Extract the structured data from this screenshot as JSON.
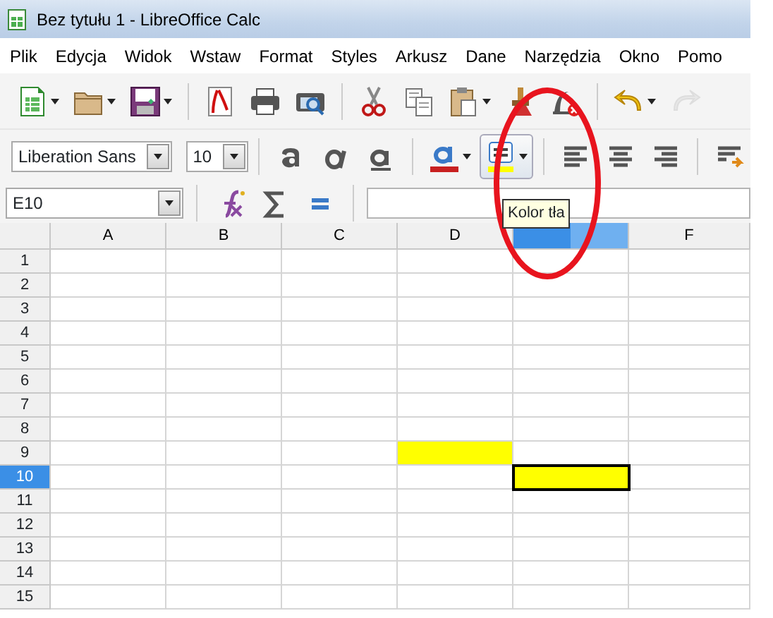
{
  "window": {
    "title": "Bez tytułu 1 - LibreOffice Calc"
  },
  "menu": [
    "Plik",
    "Edycja",
    "Widok",
    "Wstaw",
    "Format",
    "Styles",
    "Arkusz",
    "Dane",
    "Narzędzia",
    "Okno",
    "Pomo"
  ],
  "standard_toolbar": [
    {
      "dropdown": true,
      "disabled": false
    },
    {
      "dropdown": true,
      "disabled": false
    },
    {
      "dropdown": true,
      "disabled": false
    },
    {
      "dropdown": false,
      "disabled": false
    },
    {
      "dropdown": false,
      "disabled": false
    },
    {
      "dropdown": false,
      "disabled": false
    },
    {
      "dropdown": false,
      "disabled": false
    },
    {
      "dropdown": false,
      "disabled": false
    },
    {
      "dropdown": true,
      "disabled": false
    },
    {
      "dropdown": false,
      "disabled": false
    },
    {
      "dropdown": false,
      "disabled": false
    },
    {
      "dropdown": true,
      "disabled": false
    },
    {
      "dropdown": false,
      "disabled": true
    }
  ],
  "formatting_toolbar": {
    "font_name": "Liberation Sans",
    "font_size": "10",
    "buttons": [
      {
        "dropdown": false,
        "hovered": false
      },
      {
        "dropdown": false,
        "hovered": false
      },
      {
        "dropdown": false,
        "hovered": false
      },
      {
        "dropdown": true,
        "hovered": false
      },
      {
        "dropdown": true,
        "hovered": true
      },
      {
        "dropdown": false,
        "hovered": false
      },
      {
        "dropdown": false,
        "hovered": false
      },
      {
        "dropdown": false,
        "hovered": false
      },
      {
        "dropdown": false,
        "hovered": false
      }
    ]
  },
  "tooltip": "Kolor tła",
  "formula_bar": {
    "name_box": "E10"
  },
  "columns": [
    {
      "label": "A",
      "selected": false
    },
    {
      "label": "B",
      "selected": false
    },
    {
      "label": "C",
      "selected": false
    },
    {
      "label": "D",
      "selected": false
    },
    {
      "selected": true
    },
    {
      "label": "F",
      "selected": false
    }
  ],
  "rows": [
    {
      "label": "1",
      "selected": false
    },
    {
      "label": "2",
      "selected": false
    },
    {
      "label": "3",
      "selected": false
    },
    {
      "label": "4",
      "selected": false
    },
    {
      "label": "5",
      "selected": false
    },
    {
      "label": "6",
      "selected": false
    },
    {
      "label": "7",
      "selected": false
    },
    {
      "label": "8",
      "selected": false
    },
    {
      "label": "9",
      "selected": false,
      "cells": [
        {
          "selected": false
        },
        {
          "selected": false
        },
        {
          "selected": false
        },
        {
          "selected": false,
          "color": "#ffff00"
        },
        {
          "selected": false
        },
        {
          "selected": false
        }
      ]
    },
    {
      "label": "10",
      "selected": true,
      "cells": [
        {
          "selected": false
        },
        {
          "selected": false
        },
        {
          "selected": false
        },
        {
          "selected": false
        },
        {
          "selected": true,
          "color": "#ffff00"
        },
        {
          "selected": false
        }
      ]
    },
    {
      "label": "11",
      "selected": false
    },
    {
      "label": "12",
      "selected": false
    },
    {
      "label": "13",
      "selected": false
    },
    {
      "label": "14",
      "selected": false
    },
    {
      "label": "15",
      "selected": false
    }
  ]
}
